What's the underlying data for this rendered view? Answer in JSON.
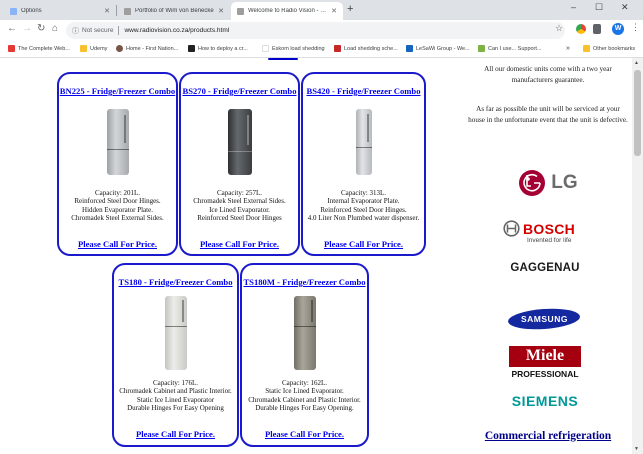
{
  "browser": {
    "tabs": [
      {
        "title": "Options",
        "fav": "#8ab4f8"
      },
      {
        "title": "Portfolio of Wim von Benecke",
        "fav": "#9e9e9e"
      },
      {
        "title": "Welcome to Radio Vision - Digita",
        "fav": "#9e9e9e"
      }
    ],
    "new_tab_icon": "+",
    "secure_label": "Not secure",
    "url": "www.radiovision.co.za/products.html",
    "avatar_letter": "W",
    "bookmarks": [
      {
        "label": "The Complete Web...",
        "icon": "#e53935"
      },
      {
        "label": "Udemy",
        "icon": "#fbc02d"
      },
      {
        "label": "Home - First Nation...",
        "icon": "#795548"
      },
      {
        "label": "How to deploy a cr...",
        "icon": "#212121"
      },
      {
        "label": "Eskom load shedding",
        "icon": "#ffffff"
      },
      {
        "label": "Load shedding sche...",
        "icon": "#c62828"
      },
      {
        "label": "LeSaWi Group - We...",
        "icon": "#1565c0"
      },
      {
        "label": "Can I use... Support...",
        "icon": "#7cb342"
      },
      {
        "label": "Other bookmarks",
        "icon": "#fbc02d"
      }
    ],
    "overflow_icon": "»"
  },
  "products": [
    {
      "title": "BN225 - Fridge/Freezer Combo",
      "color": "#b9bcbf",
      "desc": [
        "Capacity: 201L.",
        "Reinforced Steel Door Hinges.",
        "Hidden Evaporator Plate.",
        "Chromadek Steel External Sides."
      ],
      "call": "Please Call For Price."
    },
    {
      "title": "BS270 - Fridge/Freezer Combo",
      "color": "#4a4c4f",
      "desc": [
        "Capacity: 257L.",
        "Chromadek Steel External Sides.",
        "Ice Lined Evaporator.",
        "Reinforced Steel Door Hinges"
      ],
      "call": "Please Call For Price."
    },
    {
      "title": "BS420 - Fridge/Freezer Combo",
      "color": "#cfd2d6",
      "desc": [
        "Capacity: 313L.",
        "Internal Evaporator Plate.",
        "Reinforced Steel Door Hinges.",
        "4.0 Liter Non Plumbed water dispenser."
      ],
      "call": "Please Call For Price."
    },
    {
      "title": "TS180 - Fridge/Freezer Combo",
      "color": "#d8d8d4",
      "desc": [
        "Capacity: 176L.",
        "Chromadek Cabinet and Plastic Interior.",
        "Static Ice Lined Evaporator",
        "Durable Hinges For Easy Opening"
      ],
      "call": "Please Call For Price."
    },
    {
      "title": "TS180M - Fridge/Freezer Combo",
      "color": "#8d8a80",
      "desc": [
        "Capacity: 162L.",
        "Static Ice Lined Evaporator.",
        "Chromadek Cabinet and Plastic Interior.",
        "Durable Hinges For Easy Opening."
      ],
      "call": "Please Call For Price."
    }
  ],
  "sidebar": {
    "warranty": "All our domestic units come with a two year manufacturers guarantee.",
    "service": "As far as possible the unit will be serviced at your house in the unfortunate event that the unit is defective.",
    "brands": {
      "lg": "LG",
      "bosch": "BOSCH",
      "bosch_tagline": "Invented for life",
      "gaggenau": "GAGGENAU",
      "samsung": "SAMSUNG",
      "miele": "Miele",
      "miele_sub": "PROFESSIONAL",
      "siemens": "SIEMENS"
    },
    "commercial": "Commercial refrigeration"
  },
  "colors": {
    "card_border": "#1a1acc",
    "link": "#0000ee",
    "lg_red": "#a50034",
    "samsung_blue": "#1428a0",
    "miele_red": "#a5000f",
    "siemens_teal": "#009999"
  }
}
